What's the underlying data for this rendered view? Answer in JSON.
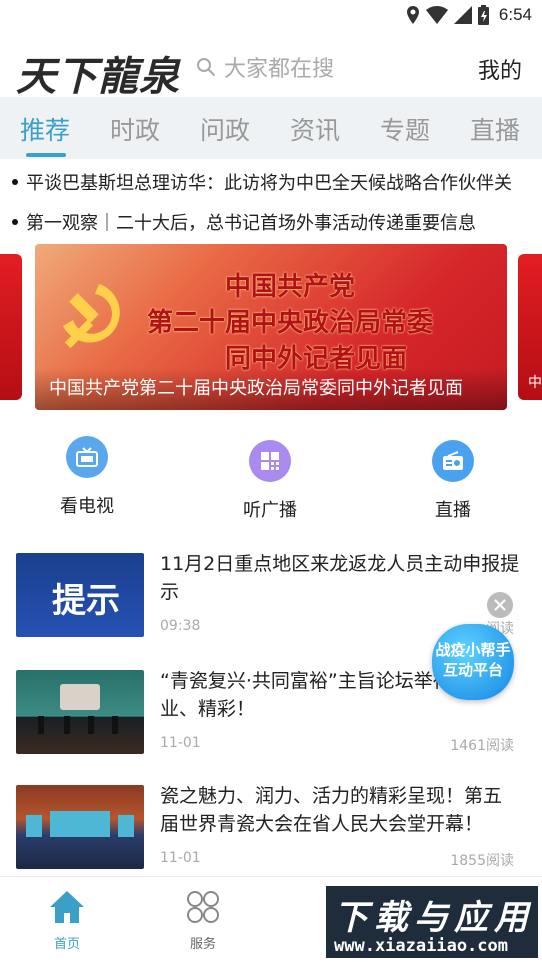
{
  "status_bar": {
    "time": "6:54"
  },
  "header": {
    "logo_text": "天下龍泉",
    "search_placeholder": "大家都在搜",
    "mine_label": "我的"
  },
  "tabs": [
    {
      "label": "推荐",
      "active": true
    },
    {
      "label": "时政"
    },
    {
      "label": "问政"
    },
    {
      "label": "资讯"
    },
    {
      "label": "专题"
    },
    {
      "label": "直播"
    }
  ],
  "headlines": [
    "平谈巴基斯坦总理访华：此访将为中巴全天候战略合作伙伴关",
    "第一观察｜二十大后，总书记首场外事活动传递重要信息"
  ],
  "banner": {
    "line1": "中国共产党",
    "line2": "第二十届中央政治局常委",
    "line3": "同中外记者见面",
    "caption": "中国共产党第二十届中央政治局常委同中外记者见面",
    "side_right_char": "中"
  },
  "quick_links": [
    {
      "label": "看电视",
      "icon": "tv-icon",
      "color": "#5aa7ee"
    },
    {
      "label": "听广播",
      "icon": "radio-grid-icon",
      "color": "#a98bf0"
    },
    {
      "label": "直播",
      "icon": "live-radio-icon",
      "color": "#4aa2ee"
    }
  ],
  "articles": [
    {
      "title": "11月2日重点地区来龙返龙人员主动申报提示",
      "time": "09:38",
      "reads": "阅读",
      "thumb_text": "提示"
    },
    {
      "title": "“青瓷复兴·共同富裕”主旨论坛举行，专业、精彩！",
      "time": "11-01",
      "reads": "1461阅读"
    },
    {
      "title": "瓷之魅力、润力、活力的精彩呈现！第五届世界青瓷大会在省人民大会堂开幕！",
      "time": "11-01",
      "reads": "1855阅读"
    }
  ],
  "floating_helper": {
    "line1": "战疫小帮手",
    "line2": "互动平台"
  },
  "bottom_nav": [
    {
      "label": "首页",
      "icon": "home-icon",
      "active": true
    },
    {
      "label": "服务",
      "icon": "services-icon"
    }
  ],
  "watermark": {
    "line1": "下载与应用",
    "line2": "www.xiazaiiao.com"
  },
  "colors": {
    "accent": "#3aa0c8",
    "banner_red": "#d6262a"
  }
}
